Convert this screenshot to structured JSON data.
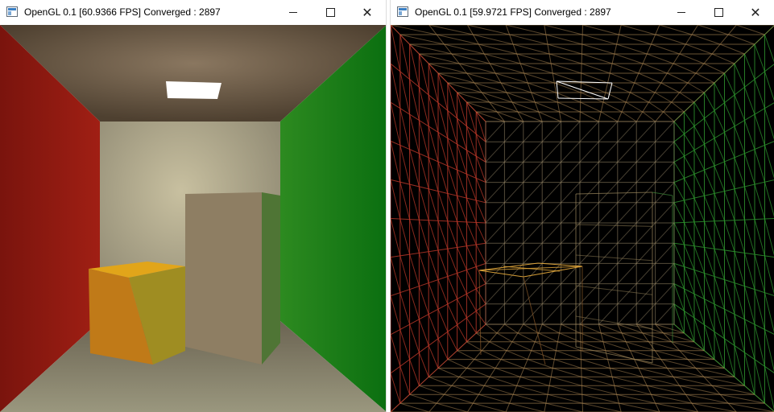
{
  "windows": [
    {
      "title": "OpenGL 0.1 [60.9366 FPS] Converged : 2897",
      "controls": {
        "minimize": "—",
        "maximize": "☐",
        "close": "✕"
      }
    },
    {
      "title": "OpenGL 0.1 [59.9721 FPS] Converged : 2897",
      "controls": {
        "minimize": "—",
        "maximize": "☐",
        "close": "✕"
      }
    }
  ],
  "colors": {
    "left_wall": "#8e1810",
    "right_wall": "#118a16",
    "back_wall": "#b9b49c",
    "floor": "#8c8872",
    "ceiling": "#6c5e48",
    "short_box": "#c08a14",
    "tall_box": "#8d7d62",
    "light": "#ffffff",
    "wire_red": "#c23a2a",
    "wire_green": "#2f9a2f",
    "wire_yellow": "#e1a63a"
  }
}
